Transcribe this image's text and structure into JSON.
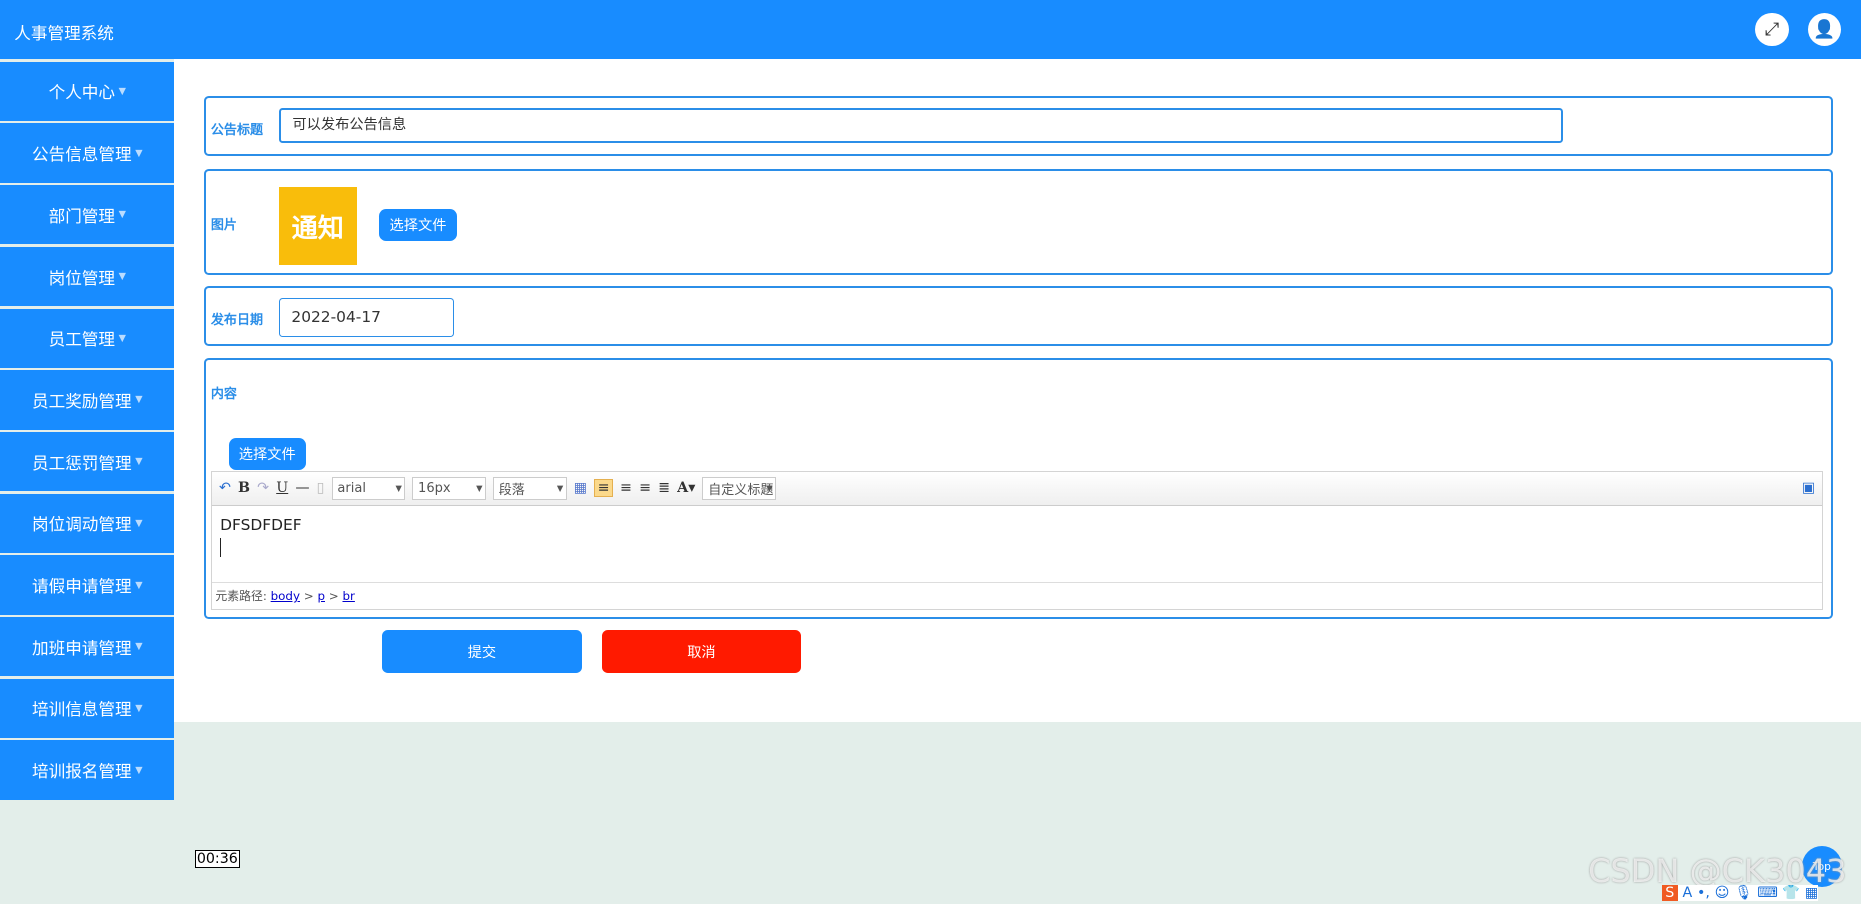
{
  "header": {
    "title": "人事管理系统",
    "fullscreen_icon": "expand-icon",
    "user_icon": "user-icon"
  },
  "sidebar": {
    "items": [
      {
        "label": "个人中心"
      },
      {
        "label": "公告信息管理"
      },
      {
        "label": "部门管理"
      },
      {
        "label": "岗位管理"
      },
      {
        "label": "员工管理"
      },
      {
        "label": "员工奖励管理"
      },
      {
        "label": "员工惩罚管理"
      },
      {
        "label": "岗位调动管理"
      },
      {
        "label": "请假申请管理"
      },
      {
        "label": "加班申请管理"
      },
      {
        "label": "培训信息管理"
      },
      {
        "label": "培训报名管理"
      }
    ]
  },
  "form": {
    "title_label": "公告标题",
    "title_value": "可以发布公告信息",
    "image_label": "图片",
    "image_text": "通知",
    "choose_file": "选择文件",
    "date_label": "发布日期",
    "date_value": "2022-04-17",
    "content_label": "内容",
    "content_choose_file": "选择文件",
    "editor": {
      "font": "arial",
      "size": "16px",
      "paragraph": "段落",
      "custom_title": "自定义标题",
      "text": "DFSDFDEF",
      "path_label": "元素路径:",
      "path": [
        "body",
        "p",
        "br"
      ]
    },
    "submit": "提交",
    "cancel": "取消"
  },
  "overlay": {
    "timer": "00:36",
    "watermark": "CSDN @CK3043",
    "top": "Top"
  },
  "colors": {
    "primary": "#188cff",
    "danger": "#ff1a00",
    "background": "#e3eeea"
  }
}
